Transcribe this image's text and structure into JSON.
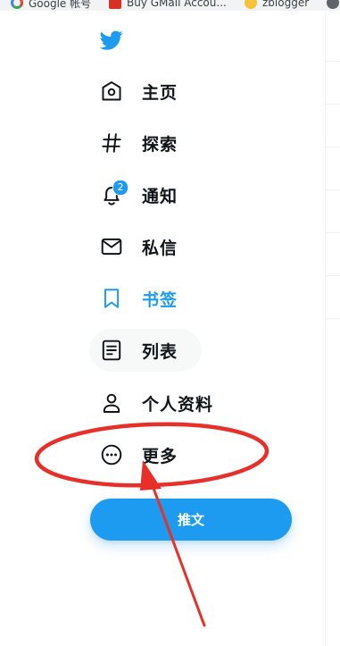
{
  "bookmarks": [
    {
      "label": "Google 帐号",
      "icon": "google-icon"
    },
    {
      "label": "Buy GMail Accou...",
      "icon": "bookmark-favicon"
    },
    {
      "label": "zblogger",
      "icon": "emoji-favicon"
    }
  ],
  "sidebar": {
    "logo": "twitter-bird-icon",
    "items": [
      {
        "label": "主页",
        "icon": "home-icon"
      },
      {
        "label": "探索",
        "icon": "hashtag-icon"
      },
      {
        "label": "通知",
        "icon": "bell-icon",
        "badge": "2"
      },
      {
        "label": "私信",
        "icon": "mail-icon"
      },
      {
        "label": "书签",
        "icon": "bookmark-icon",
        "active": true
      },
      {
        "label": "列表",
        "icon": "list-icon"
      },
      {
        "label": "个人资料",
        "icon": "profile-icon"
      },
      {
        "label": "更多",
        "icon": "more-icon"
      }
    ],
    "tweet_button": "推文"
  },
  "colors": {
    "accent": "#1d9bf0",
    "text": "#0f1419",
    "annotation": "#e8302a"
  }
}
